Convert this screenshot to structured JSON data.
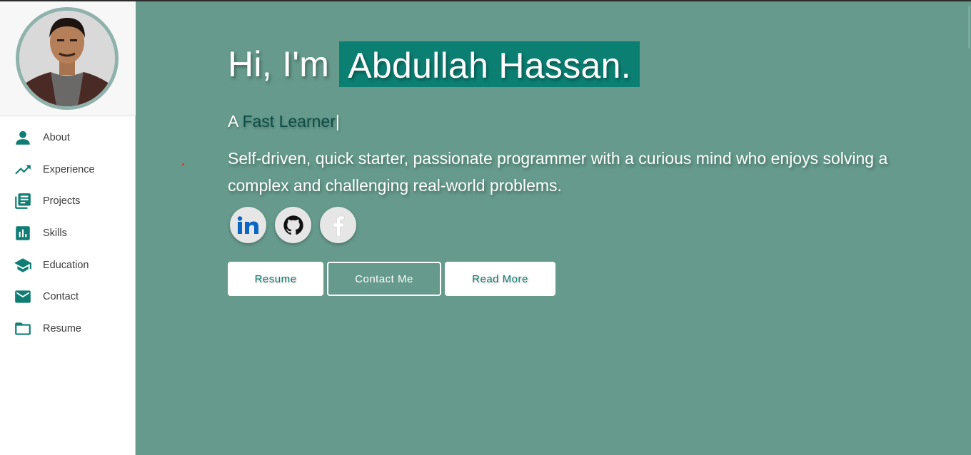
{
  "profile": {
    "photo_alt": "Abdullah Hassan portrait"
  },
  "sidebar": {
    "items": [
      {
        "label": "About",
        "icon": "person-icon"
      },
      {
        "label": "Experience",
        "icon": "trending-up-icon"
      },
      {
        "label": "Projects",
        "icon": "library-books-icon"
      },
      {
        "label": "Skills",
        "icon": "bar-chart-icon"
      },
      {
        "label": "Education",
        "icon": "graduation-cap-icon"
      },
      {
        "label": "Contact",
        "icon": "mail-icon"
      },
      {
        "label": "Resume",
        "icon": "folder-icon"
      }
    ]
  },
  "hero": {
    "greeting": "Hi, I'm",
    "name": "Abdullah Hassan.",
    "subtitle_prefix": "A",
    "typed_text": "Fast Learner",
    "cursor": "|",
    "description": "Self-driven, quick starter, passionate programmer with a curious mind who enjoys solving a complex and challenging real-world problems."
  },
  "social": [
    {
      "name": "LinkedIn",
      "icon": "linkedin-icon"
    },
    {
      "name": "GitHub",
      "icon": "github-icon"
    },
    {
      "name": "Facebook",
      "icon": "facebook-icon"
    }
  ],
  "buttons": {
    "resume": "Resume",
    "contact": "Contact Me",
    "read_more": "Read More"
  },
  "colors": {
    "accent": "#0c7f73",
    "background": "#659a8c",
    "sidebar_bg": "#ffffff"
  }
}
